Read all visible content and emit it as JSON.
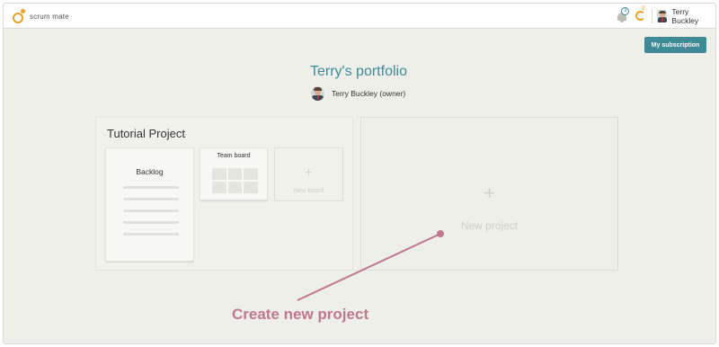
{
  "app": {
    "logo_text": "scrum mate",
    "brand_color": "#e9a22a",
    "accent_color": "#3f8a97"
  },
  "header": {
    "notifications_count": "3",
    "sync_count": "2",
    "user_name": "Terry Buckley",
    "subscription_button": "My subscription"
  },
  "portfolio": {
    "title": "Terry's portfolio",
    "owner_label": "Terry Buckley (owner)"
  },
  "project": {
    "title": "Tutorial Project",
    "boards": [
      {
        "label": "Backlog"
      },
      {
        "label": "Team board"
      },
      {
        "label": "New board",
        "icon": "plus-icon"
      }
    ]
  },
  "new_project": {
    "label": "New project",
    "icon": "plus-icon"
  },
  "annotation": {
    "text": "Create new project",
    "color": "#c07890"
  }
}
